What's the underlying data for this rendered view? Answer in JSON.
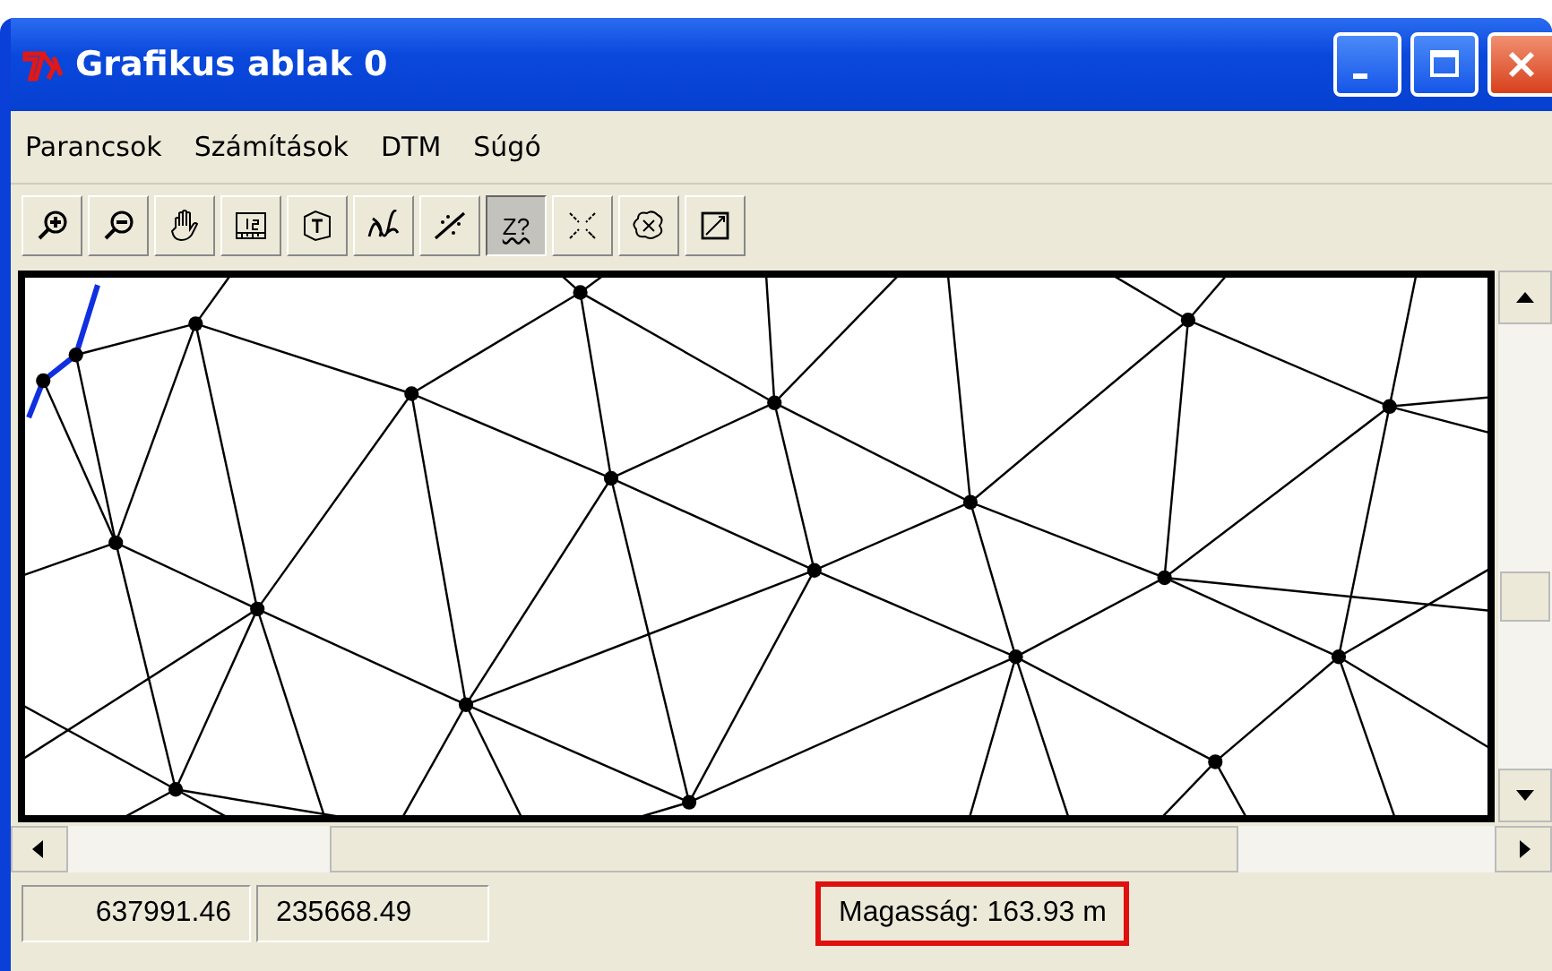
{
  "window": {
    "title": "Grafikus ablak 0"
  },
  "menu": [
    "Parancsok",
    "Számítások",
    "DTM",
    "Súgó"
  ],
  "toolbar": [
    {
      "kind": "zoom-in",
      "selected": false
    },
    {
      "kind": "zoom-out",
      "selected": false
    },
    {
      "kind": "pan",
      "selected": false
    },
    {
      "kind": "scale",
      "selected": false
    },
    {
      "kind": "label",
      "selected": false
    },
    {
      "kind": "polyline",
      "selected": false
    },
    {
      "kind": "points",
      "selected": false
    },
    {
      "kind": "height",
      "glyph": "Z?",
      "selected": true
    },
    {
      "kind": "cross",
      "selected": false
    },
    {
      "kind": "blob",
      "selected": false
    },
    {
      "kind": "extent",
      "selected": false
    }
  ],
  "status_bar": [
    {
      "text": "637991.46",
      "highlighted": false
    },
    {
      "text": "235668.49",
      "highlighted": false
    },
    {
      "text": "Magasság: 163.93 m",
      "highlighted": true
    }
  ]
}
